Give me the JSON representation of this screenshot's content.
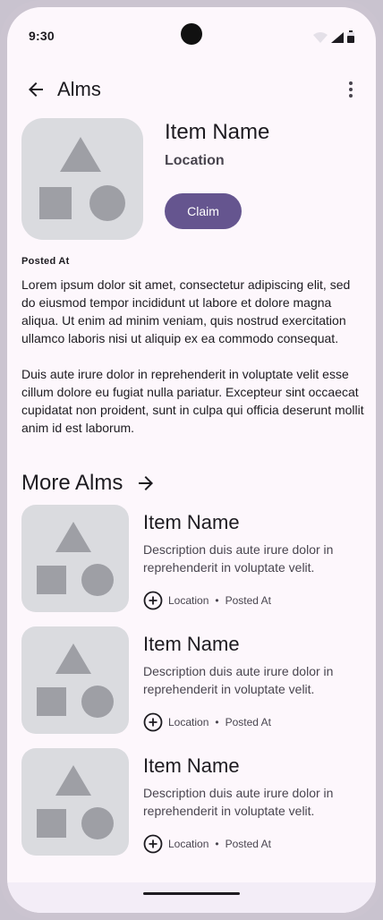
{
  "status_bar": {
    "time": "9:30"
  },
  "app_bar": {
    "title": "Alms"
  },
  "hero": {
    "title": "Item Name",
    "location": "Location",
    "claim_label": "Claim",
    "posted_at": "Posted At"
  },
  "body": {
    "paragraph_1": "Lorem ipsum dolor sit amet, consectetur adipiscing elit, sed do eiusmod tempor incididunt ut labore et dolore magna aliqua. Ut enim ad minim veniam, quis nostrud exercitation ullamco laboris nisi ut aliquip ex ea commodo consequat.",
    "paragraph_2": "Duis aute irure dolor in reprehenderit in voluptate velit esse cillum dolore eu fugiat nulla pariatur. Excepteur sint occaecat cupidatat non proident, sunt in culpa qui officia deserunt mollit anim id est laborum."
  },
  "more_section": {
    "title": "More Alms"
  },
  "list": {
    "items": [
      {
        "title": "Item Name",
        "description": "Description duis aute irure dolor in reprehenderit in voluptate velit.",
        "location": "Location",
        "separator": "•",
        "posted_at": "Posted At"
      },
      {
        "title": "Item Name",
        "description": "Description duis aute irure dolor in reprehenderit in voluptate velit.",
        "location": "Location",
        "separator": "•",
        "posted_at": "Posted At"
      },
      {
        "title": "Item Name",
        "description": "Description duis aute irure dolor in reprehenderit in voluptate velit.",
        "location": "Location",
        "separator": "•",
        "posted_at": "Posted At"
      }
    ]
  },
  "icons": {
    "back": "arrow-back-icon",
    "more": "more-vert-icon",
    "forward": "arrow-forward-icon",
    "add": "add-circle-icon",
    "wifi": "wifi-icon",
    "signal": "signal-icon",
    "battery": "battery-icon"
  },
  "colors": {
    "background": "#fdf7fc",
    "primary": "#65558f",
    "placeholder_bg": "#dadbdf",
    "placeholder_shape": "#9e9fa5"
  }
}
